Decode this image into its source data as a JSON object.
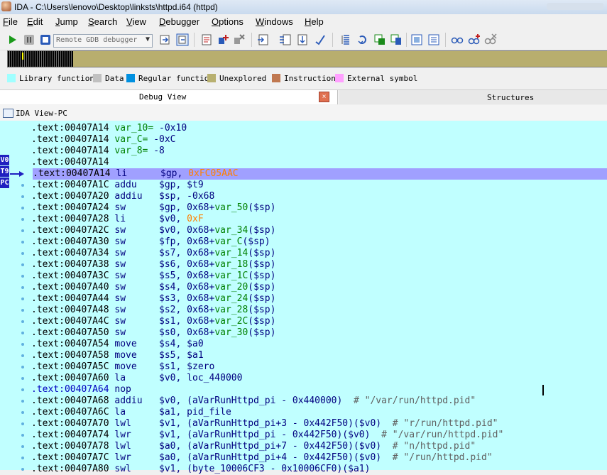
{
  "window": {
    "title": "IDA - C:\\Users\\lenovo\\Desktop\\linksts\\httpd.i64 (httpd)"
  },
  "menu": [
    "File",
    "Edit",
    "Jump",
    "Search",
    "View",
    "Debugger",
    "Options",
    "Windows",
    "Help"
  ],
  "menu_mnemonics": [
    "F",
    "E",
    "J",
    "S",
    "V",
    "D",
    "O",
    "W",
    "H"
  ],
  "toolbar": {
    "debugger_select": "Remote GDB debugger",
    "icons": [
      "play-icon",
      "pause-icon",
      "stop-icon",
      "attach-icon",
      "detach-icon",
      "process-icon",
      "breakpoint-add-icon",
      "breakpoint-del-icon",
      "step-into-icon",
      "step-over-icon",
      "run-to-cursor-icon",
      "step-out-icon",
      "trace-icon",
      "stack-icon",
      "threads-icon",
      "modules-icon",
      "watch-icon",
      "breakpoints-icon"
    ]
  },
  "legend": [
    {
      "label": "Library function",
      "color": "#a0ffff"
    },
    {
      "label": "Data",
      "color": "#c0c0c0"
    },
    {
      "label": "Regular function",
      "color": "#0090e0"
    },
    {
      "label": "Unexplored",
      "color": "#b8b070"
    },
    {
      "label": "Instruction",
      "color": "#c07850"
    },
    {
      "label": "External symbol",
      "color": "#ffa0ff"
    }
  ],
  "tabs": {
    "debug_view": "Debug View",
    "structures": "Structures",
    "close": "×"
  },
  "view_title": "IDA View-PC",
  "register_tags": [
    "V0",
    "T9",
    "PC"
  ],
  "lines": [
    {
      "addr": ".text:00407A14",
      "mn": "var_10=",
      "ops": [
        [
          "op",
          " -0x10"
        ]
      ]
    },
    {
      "addr": ".text:00407A14",
      "mn": "var_C=",
      "ops": [
        [
          "op",
          " -0xC"
        ]
      ]
    },
    {
      "addr": ".text:00407A14",
      "mn": "var_8=",
      "ops": [
        [
          "op",
          " -8"
        ]
      ]
    },
    {
      "addr": ".text:00407A14",
      "mn": "",
      "ops": []
    },
    {
      "addr": ".text:00407A14",
      "mn": "li",
      "ops": [
        [
          "op",
          "$gp, "
        ],
        [
          "nm",
          "0xFC05AAC"
        ]
      ],
      "highlight": true
    },
    {
      "addr": ".text:00407A1C",
      "mn": "addu",
      "ops": [
        [
          "op",
          "$gp, $t9"
        ]
      ]
    },
    {
      "addr": ".text:00407A20",
      "mn": "addiu",
      "ops": [
        [
          "op",
          "$sp, -0x68"
        ]
      ]
    },
    {
      "addr": ".text:00407A24",
      "mn": "sw",
      "ops": [
        [
          "op",
          "$gp, 0x68+"
        ],
        [
          "vr",
          "var_50"
        ],
        [
          "op",
          "($sp)"
        ]
      ]
    },
    {
      "addr": ".text:00407A28",
      "mn": "li",
      "ops": [
        [
          "op",
          "$v0, "
        ],
        [
          "nm",
          "0xF"
        ]
      ]
    },
    {
      "addr": ".text:00407A2C",
      "mn": "sw",
      "ops": [
        [
          "op",
          "$v0, 0x68+"
        ],
        [
          "vr",
          "var_34"
        ],
        [
          "op",
          "($sp)"
        ]
      ]
    },
    {
      "addr": ".text:00407A30",
      "mn": "sw",
      "ops": [
        [
          "op",
          "$fp, 0x68+"
        ],
        [
          "vr",
          "var_C"
        ],
        [
          "op",
          "($sp)"
        ]
      ]
    },
    {
      "addr": ".text:00407A34",
      "mn": "sw",
      "ops": [
        [
          "op",
          "$s7, 0x68+"
        ],
        [
          "vr",
          "var_14"
        ],
        [
          "op",
          "($sp)"
        ]
      ]
    },
    {
      "addr": ".text:00407A38",
      "mn": "sw",
      "ops": [
        [
          "op",
          "$s6, 0x68+"
        ],
        [
          "vr",
          "var_18"
        ],
        [
          "op",
          "($sp)"
        ]
      ]
    },
    {
      "addr": ".text:00407A3C",
      "mn": "sw",
      "ops": [
        [
          "op",
          "$s5, 0x68+"
        ],
        [
          "vr",
          "var_1C"
        ],
        [
          "op",
          "($sp)"
        ]
      ]
    },
    {
      "addr": ".text:00407A40",
      "mn": "sw",
      "ops": [
        [
          "op",
          "$s4, 0x68+"
        ],
        [
          "vr",
          "var_20"
        ],
        [
          "op",
          "($sp)"
        ]
      ]
    },
    {
      "addr": ".text:00407A44",
      "mn": "sw",
      "ops": [
        [
          "op",
          "$s3, 0x68+"
        ],
        [
          "vr",
          "var_24"
        ],
        [
          "op",
          "($sp)"
        ]
      ]
    },
    {
      "addr": ".text:00407A48",
      "mn": "sw",
      "ops": [
        [
          "op",
          "$s2, 0x68+"
        ],
        [
          "vr",
          "var_28"
        ],
        [
          "op",
          "($sp)"
        ]
      ]
    },
    {
      "addr": ".text:00407A4C",
      "mn": "sw",
      "ops": [
        [
          "op",
          "$s1, 0x68+"
        ],
        [
          "vr",
          "var_2C"
        ],
        [
          "op",
          "($sp)"
        ]
      ]
    },
    {
      "addr": ".text:00407A50",
      "mn": "sw",
      "ops": [
        [
          "op",
          "$s0, 0x68+"
        ],
        [
          "vr",
          "var_30"
        ],
        [
          "op",
          "($sp)"
        ]
      ]
    },
    {
      "addr": ".text:00407A54",
      "mn": "move",
      "ops": [
        [
          "op",
          "$s4, $a0"
        ]
      ]
    },
    {
      "addr": ".text:00407A58",
      "mn": "move",
      "ops": [
        [
          "op",
          "$s5, $a1"
        ]
      ]
    },
    {
      "addr": ".text:00407A5C",
      "mn": "move",
      "ops": [
        [
          "op",
          "$s1, $zero"
        ]
      ]
    },
    {
      "addr": ".text:00407A60",
      "mn": "la",
      "ops": [
        [
          "op",
          "$v0, loc_440000"
        ]
      ]
    },
    {
      "addr": ".text:00407A64",
      "mn": "nop",
      "ops": [],
      "addr_blue": true
    },
    {
      "addr": ".text:00407A68",
      "mn": "addiu",
      "ops": [
        [
          "op",
          "$v0, (aVarRunHttpd_pi - 0x440000)  "
        ],
        [
          "cm",
          "# \"/var/run/httpd.pid\""
        ]
      ]
    },
    {
      "addr": ".text:00407A6C",
      "mn": "la",
      "ops": [
        [
          "op",
          "$a1, pid_file"
        ]
      ]
    },
    {
      "addr": ".text:00407A70",
      "mn": "lwl",
      "ops": [
        [
          "op",
          "$v1, (aVarRunHttpd_pi+3 - 0x442F50)($v0)  "
        ],
        [
          "cm",
          "# \"r/run/httpd.pid\""
        ]
      ]
    },
    {
      "addr": ".text:00407A74",
      "mn": "lwr",
      "ops": [
        [
          "op",
          "$v1, (aVarRunHttpd_pi - 0x442F50)($v0)  "
        ],
        [
          "cm",
          "# \"/var/run/httpd.pid\""
        ]
      ]
    },
    {
      "addr": ".text:00407A78",
      "mn": "lwl",
      "ops": [
        [
          "op",
          "$a0, (aVarRunHttpd_pi+7 - 0x442F50)($v0)  "
        ],
        [
          "cm",
          "# \"n/httpd.pid\""
        ]
      ]
    },
    {
      "addr": ".text:00407A7C",
      "mn": "lwr",
      "ops": [
        [
          "op",
          "$a0, (aVarRunHttpd_pi+4 - 0x442F50)($v0)  "
        ],
        [
          "cm",
          "# \"/run/httpd.pid\""
        ]
      ]
    },
    {
      "addr": ".text:00407A80",
      "mn": "swl",
      "ops": [
        [
          "op",
          "$v1, (byte_10006CF3 - 0x10006CF0)($a1)"
        ]
      ]
    }
  ]
}
